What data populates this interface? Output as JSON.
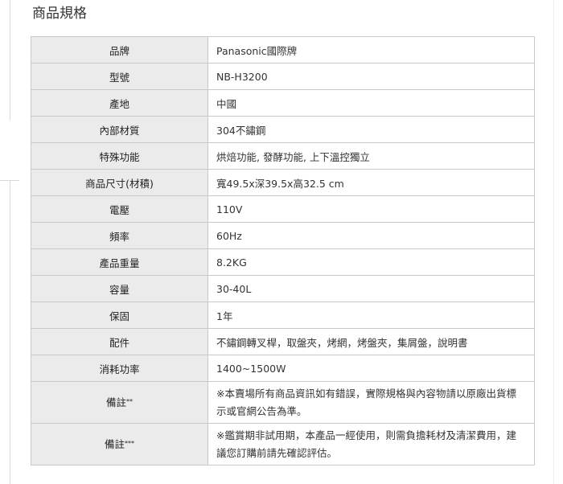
{
  "section_title": "商品規格",
  "specs": [
    {
      "label": "品牌",
      "value": "Panasonic國際牌"
    },
    {
      "label": "型號",
      "value": "NB-H3200"
    },
    {
      "label": "產地",
      "value": "中國"
    },
    {
      "label": "內部材質",
      "value": "304不鏽鋼"
    },
    {
      "label": "特殊功能",
      "value": "烘焙功能, 發酵功能, 上下溫控獨立"
    },
    {
      "label": "商品尺寸(材積)",
      "value": "寬49.5x深39.5x高32.5 cm"
    },
    {
      "label": "電壓",
      "value": "110V"
    },
    {
      "label": "頻率",
      "value": "60Hz"
    },
    {
      "label": "產品重量",
      "value": "8.2KG"
    },
    {
      "label": "容量",
      "value": "30-40L"
    },
    {
      "label": "保固",
      "value": "1年"
    },
    {
      "label": "配件",
      "value": "不鏽鋼轉叉桿，取盤夾，烤網，烤盤夾，集屑盤，說明書"
    },
    {
      "label": "消耗功率",
      "value": "1400~1500W"
    },
    {
      "label": "備註",
      "mark": "**",
      "value": "※本賣場所有商品資訊如有錯誤，實際規格與內容物請以原廠出貨標示或官網公告為準。"
    },
    {
      "label": "備註",
      "mark": "***",
      "value": "※鑑賞期非試用期，本產品一經使用，則需負擔耗材及清潔費用，建議您訂購前請先確認評估。"
    }
  ]
}
